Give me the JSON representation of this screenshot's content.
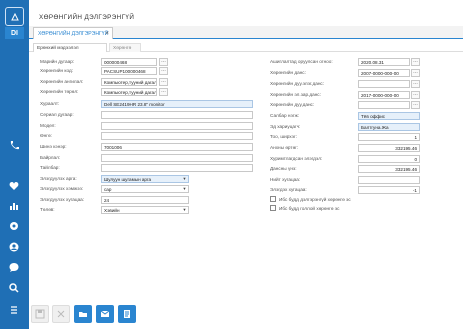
{
  "app": {
    "logo_text": "DI",
    "window_title": "ХӨРӨНГИЙН ДЭЛГЭРЭНГҮЙ"
  },
  "tabs": [
    {
      "label": "ХӨРӨНГИЙН ДЭЛГЭРЭНГҮЙ",
      "close": "×"
    }
  ],
  "subtabs": [
    {
      "label": "Ерөнхий мэдээлэл"
    },
    {
      "label": "Хөрөнгө"
    }
  ],
  "left_fields": [
    {
      "label": "Марийн дугаар:",
      "value": "000000468"
    },
    {
      "label": "Хөрөнгийн код:",
      "value": "PACSUP100000468"
    },
    {
      "label": "Хөрөнгийн ангилал:",
      "value": "Компьютер,тууний дагал..."
    },
    {
      "label": "Хөрөнгийн төрөл:",
      "value": "Компьютер,тууний дагал..."
    },
    {
      "label": "Хураалт:",
      "value": "Dell SE2419HR 23.8\" monitor"
    },
    {
      "label": "Сериал дугаар:",
      "value": ""
    },
    {
      "label": "Модел:",
      "value": ""
    },
    {
      "label": "Өнгө:",
      "value": ""
    },
    {
      "label": "Шинэ кэнэр:",
      "value": "7001006"
    },
    {
      "label": "Байрлал:",
      "value": ""
    },
    {
      "label": "Тайлбар:",
      "value": ""
    },
    {
      "label": "Элэгдүүлэх арга:",
      "value": "Шулуун шугамын арга"
    },
    {
      "label": "Элэгдүүлэх хэмжээ:",
      "value": "сар"
    },
    {
      "label": "Элэгдүүлэх хугацаа:",
      "value": "24"
    },
    {
      "label": "Төлөв:",
      "value": "Хэвийн"
    }
  ],
  "right_fields": [
    {
      "label": "Ашиглалтад оруулсан огноо:",
      "value": "2020.08.31"
    },
    {
      "label": "Хөрөнгийн данс:",
      "value": "2007-0000-000-00"
    },
    {
      "label": "Хөрөнгийн дуу.элэг.данс:",
      "value": ""
    },
    {
      "label": "Хөрөнгийн эл.зар.данс:",
      "value": "2017-0000-000-00"
    },
    {
      "label": "Хөрөнгийн дуу.данс:",
      "value": ""
    },
    {
      "label": "Салбар нэгж:",
      "value": "Тёв оффис"
    },
    {
      "label": "Эд хариуцагч:",
      "value": "Балтгуна.Жа"
    },
    {
      "label": "Тоо, ширхэг:",
      "value": "1"
    },
    {
      "label": "Анхны өртөг:",
      "value": "332195.46"
    },
    {
      "label": "Хуримтлагдсан элэгдэл:",
      "value": "0"
    },
    {
      "label": "Дансны үнэ:",
      "value": "332195.46"
    },
    {
      "label": "Нийт хугацаа:",
      "value": ""
    },
    {
      "label": "Элэгдэх хугацаа:",
      "value": "-1"
    }
  ],
  "checkboxes": [
    {
      "label": "Ибс будд дэлгэрэнгүй хөрөнгө эс"
    },
    {
      "label": "Ибс будд голлой хөрөнгө эс"
    }
  ],
  "rail_icons": [
    "phone-icon",
    "heart-icon",
    "chart-icon",
    "gear-icon",
    "user-icon",
    "chat-icon",
    "search-icon",
    "settings-icon"
  ],
  "footer": {
    "buttons": [
      "save-icon",
      "print-icon",
      "folder-icon",
      "message-icon",
      "copy-icon"
    ]
  }
}
